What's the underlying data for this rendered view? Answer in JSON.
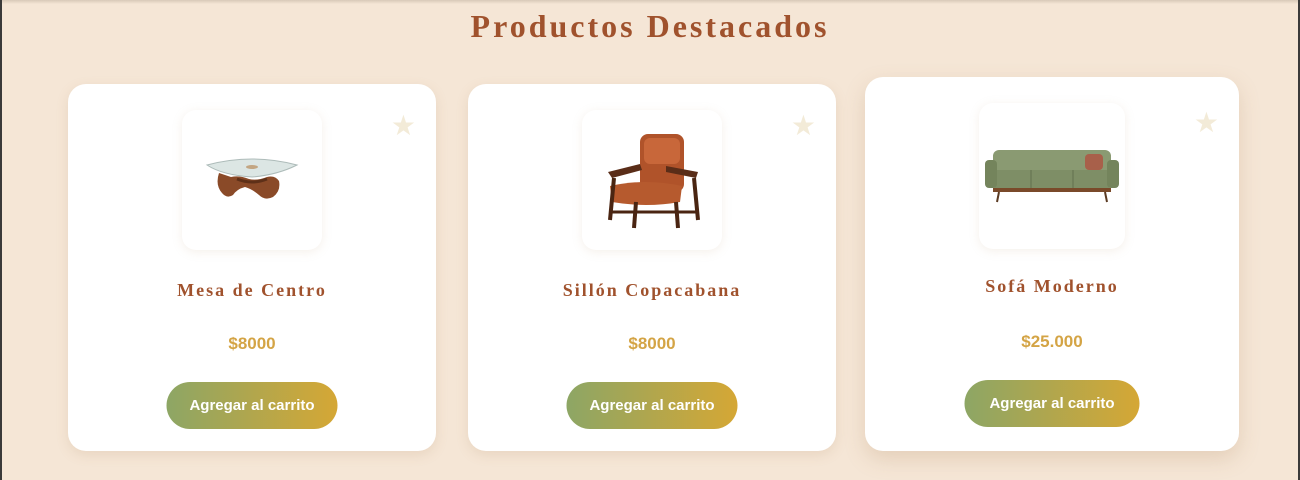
{
  "section": {
    "title": "Productos Destacados"
  },
  "products": [
    {
      "name": "Mesa de Centro",
      "price": "$8000",
      "button_label": "Agregar al carrito",
      "favorite_icon": "star-icon",
      "image": "coffee-table"
    },
    {
      "name": "Sillón Copacabana",
      "price": "$8000",
      "button_label": "Agregar al carrito",
      "favorite_icon": "star-icon",
      "image": "leather-armchair"
    },
    {
      "name": "Sofá Moderno",
      "price": "$25.000",
      "button_label": "Agregar al carrito",
      "favorite_icon": "star-icon",
      "image": "green-sofa"
    }
  ],
  "colors": {
    "background": "#f5e6d6",
    "title": "#a0522d",
    "price": "#d4a445",
    "button_gradient_start": "#8da665",
    "button_gradient_end": "#d5a735",
    "star": "#f3ebd8"
  }
}
